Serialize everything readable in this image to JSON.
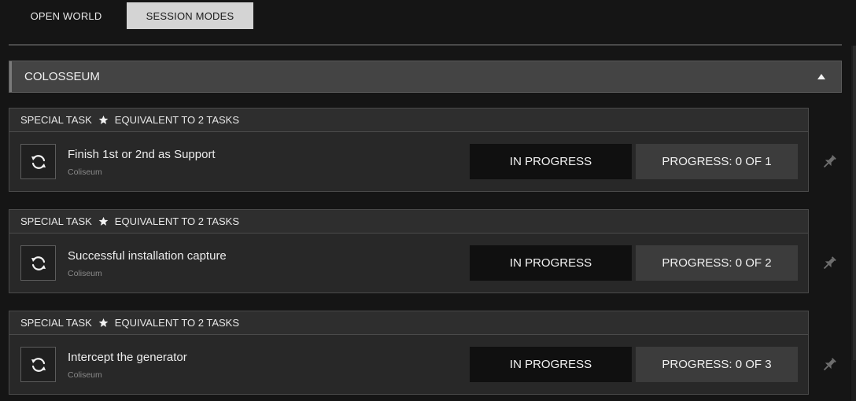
{
  "tabs": [
    {
      "label": "OPEN WORLD",
      "active": false
    },
    {
      "label": "SESSION MODES",
      "active": true
    }
  ],
  "section": {
    "title": "COLOSSEUM",
    "expanded": true,
    "icon": "caret-up-icon"
  },
  "tasks": [
    {
      "type": "SPECIAL TASK",
      "equivalent": "EQUIVALENT TO 2 TASKS",
      "name": "Finish 1st or 2nd as Support",
      "location": "Coliseum",
      "status": "IN PROGRESS",
      "progress": "PROGRESS: 0 OF 1",
      "current": 0,
      "total": 1
    },
    {
      "type": "SPECIAL TASK",
      "equivalent": "EQUIVALENT TO 2 TASKS",
      "name": "Successful installation capture",
      "location": "Coliseum",
      "status": "IN PROGRESS",
      "progress": "PROGRESS: 0 OF 2",
      "current": 0,
      "total": 2
    },
    {
      "type": "SPECIAL TASK",
      "equivalent": "EQUIVALENT TO 2 TASKS",
      "name": "Intercept the generator",
      "location": "Coliseum",
      "status": "IN PROGRESS",
      "progress": "PROGRESS: 0 OF 3",
      "current": 0,
      "total": 3
    }
  ],
  "icons": {
    "star": "star-icon",
    "refresh": "refresh-icon",
    "pin": "pin-icon"
  },
  "colors": {
    "background": "#151515",
    "active_tab": "#d4d4d4",
    "section_header": "#444444",
    "card_body": "#282828",
    "status_bg": "#101010",
    "progress_bg": "#3c3c3c",
    "pin": "#6e6e6e"
  }
}
